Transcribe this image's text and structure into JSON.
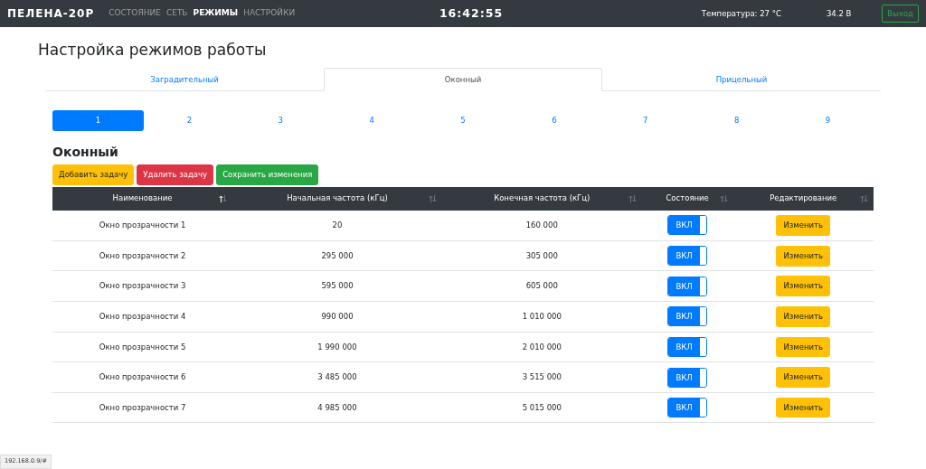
{
  "navbar": {
    "brand": "ПЕЛЕНА-20Р",
    "links": [
      {
        "label": "СОСТОЯНИЕ",
        "selected": false
      },
      {
        "label": "СЕТЬ",
        "selected": false
      },
      {
        "label": "РЕЖИМЫ",
        "selected": true
      },
      {
        "label": "НАСТРОЙКИ",
        "selected": false
      }
    ],
    "clock": "16:42:55",
    "temperature": "Температура: 27 °C",
    "voltage": "34.2 В",
    "logout": "Выход"
  },
  "page_title": "Настройка режимов работы",
  "tabs": [
    {
      "label": "Заградительный",
      "selected": false
    },
    {
      "label": "Оконный",
      "selected": true
    },
    {
      "label": "Прицельный",
      "selected": false
    }
  ],
  "pills": [
    {
      "label": "1",
      "selected": true
    },
    {
      "label": "2",
      "selected": false
    },
    {
      "label": "3",
      "selected": false
    },
    {
      "label": "4",
      "selected": false
    },
    {
      "label": "5",
      "selected": false
    },
    {
      "label": "6",
      "selected": false
    },
    {
      "label": "7",
      "selected": false
    },
    {
      "label": "8",
      "selected": false
    },
    {
      "label": "9",
      "selected": false
    }
  ],
  "section_title": "Оконный",
  "actions": [
    {
      "label": "Добавить задачу",
      "kind": "warning"
    },
    {
      "label": "Удалить задачу",
      "kind": "danger"
    },
    {
      "label": "Сохранить изменения",
      "kind": "success"
    }
  ],
  "table": {
    "columns": [
      {
        "label": "Наименование",
        "sorted": true
      },
      {
        "label": "Начальная частота (кГц)",
        "sorted": false
      },
      {
        "label": "Конечная частота (кГц)",
        "sorted": false
      },
      {
        "label": "Состояние",
        "sorted": false
      },
      {
        "label": "Редактирование",
        "sorted": false
      }
    ],
    "rows": [
      {
        "name": "Окно прозрачности 1",
        "start": "20",
        "end": "160 000",
        "state": "ВКЛ",
        "on": true,
        "edit": "Изменить"
      },
      {
        "name": "Окно прозрачности 2",
        "start": "295 000",
        "end": "305 000",
        "state": "ВКЛ",
        "on": true,
        "edit": "Изменить"
      },
      {
        "name": "Окно прозрачности 3",
        "start": "595 000",
        "end": "605 000",
        "state": "ВКЛ",
        "on": true,
        "edit": "Изменить"
      },
      {
        "name": "Окно прозрачности 4",
        "start": "990 000",
        "end": "1 010 000",
        "state": "ВКЛ",
        "on": true,
        "edit": "Изменить"
      },
      {
        "name": "Окно прозрачности 5",
        "start": "1 990 000",
        "end": "2 010 000",
        "state": "ВКЛ",
        "on": true,
        "edit": "Изменить"
      },
      {
        "name": "Окно прозрачности 6",
        "start": "3 485 000",
        "end": "3 515 000",
        "state": "ВКЛ",
        "on": true,
        "edit": "Изменить"
      },
      {
        "name": "Окно прозрачности 7",
        "start": "4 985 000",
        "end": "5 015 000",
        "state": "ВКЛ",
        "on": true,
        "edit": "Изменить"
      }
    ]
  },
  "status_bar": {
    "url": "192.168.0.9/#"
  }
}
